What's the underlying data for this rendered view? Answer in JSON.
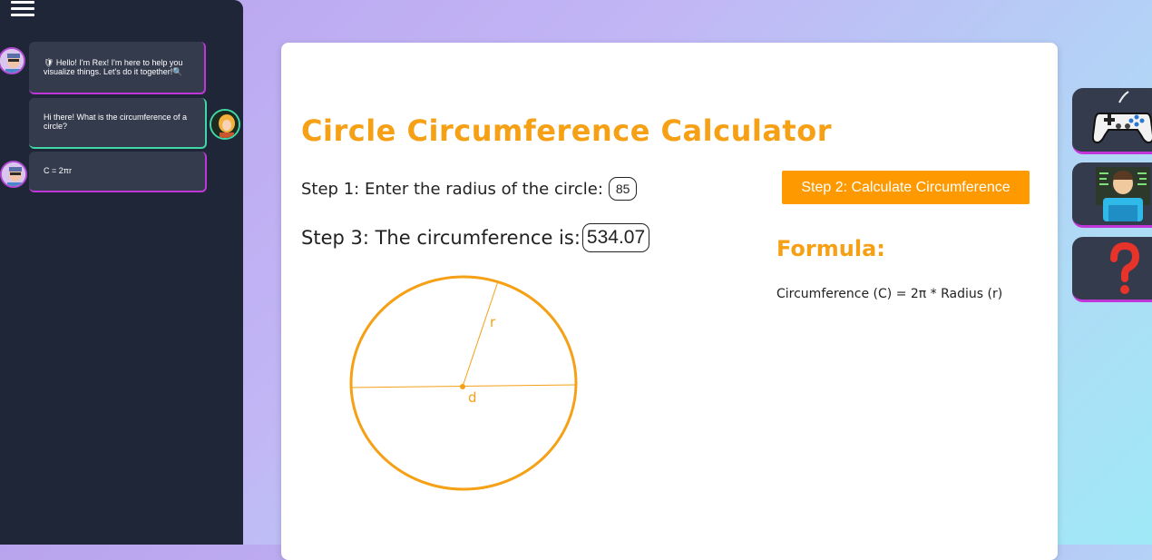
{
  "chat": {
    "messages": [
      {
        "role": "bot",
        "text": "🛡 Hello! I'm Rex! I'm here to help you visualize things. Let's do it together!🔍"
      },
      {
        "role": "user",
        "text": "Hi there! What is the circumference of a circle?"
      },
      {
        "role": "bot",
        "text": "C = 2πr"
      }
    ]
  },
  "calculator": {
    "title": "Circle Circumference Calculator",
    "step1_label": "Step 1: Enter the radius of the circle:",
    "radius_value": "85",
    "step2_button": "Step 2: Calculate Circumference",
    "step3_label": "Step 3: The circumference is:",
    "result_value": "534.07",
    "formula_heading": "Formula:",
    "formula_text": "Circumference (C) = 2π * Radius (r)"
  },
  "diagram": {
    "radius_label": "r",
    "diameter_label": "d",
    "color": "#f5a015"
  },
  "side_buttons": [
    {
      "icon": "game-controller-icon"
    },
    {
      "icon": "developer-icon"
    },
    {
      "icon": "question-mark-icon"
    }
  ],
  "colors": {
    "accent_orange": "#ff9900",
    "bot_border": "#c136d9",
    "user_border": "#3fd7a6",
    "sidebar_bg": "#1f2637"
  }
}
